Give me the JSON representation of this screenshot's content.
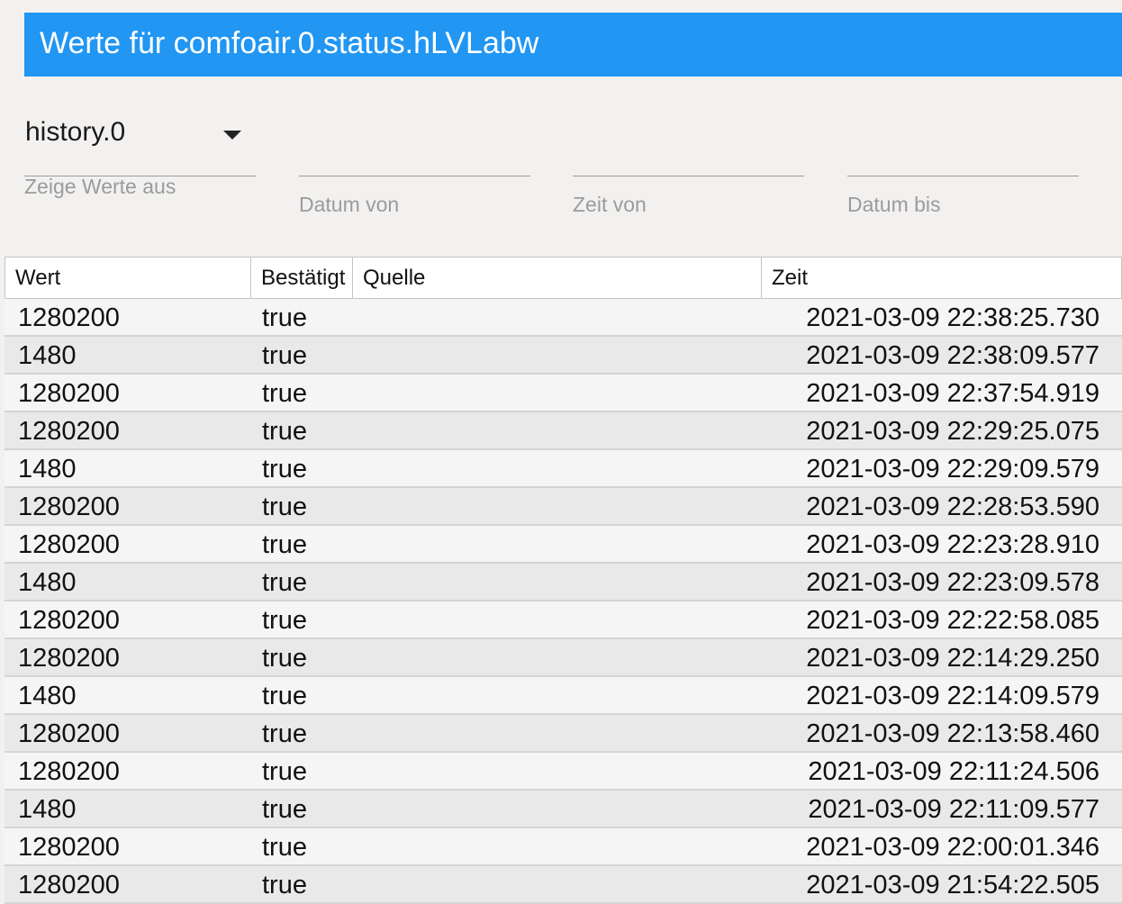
{
  "window": {
    "title": "Werte für comfoair.0.status.hLVLabw"
  },
  "filters": {
    "instance": {
      "value": "history.0",
      "label": "Zeige Werte aus"
    },
    "date_from": {
      "label": "Datum von",
      "value": ""
    },
    "time_from": {
      "label": "Zeit von",
      "value": ""
    },
    "date_to": {
      "label": "Datum bis",
      "value": ""
    }
  },
  "table": {
    "headers": {
      "value": "Wert",
      "ack": "Bestätigt",
      "from": "Quelle",
      "ts": "Zeit"
    },
    "rows": [
      {
        "value": "1280200",
        "ack": "true",
        "from": "",
        "ts": "2021-03-09 22:38:25.730"
      },
      {
        "value": "1480",
        "ack": "true",
        "from": "",
        "ts": "2021-03-09 22:38:09.577"
      },
      {
        "value": "1280200",
        "ack": "true",
        "from": "",
        "ts": "2021-03-09 22:37:54.919"
      },
      {
        "value": "1280200",
        "ack": "true",
        "from": "",
        "ts": "2021-03-09 22:29:25.075"
      },
      {
        "value": "1480",
        "ack": "true",
        "from": "",
        "ts": "2021-03-09 22:29:09.579"
      },
      {
        "value": "1280200",
        "ack": "true",
        "from": "",
        "ts": "2021-03-09 22:28:53.590"
      },
      {
        "value": "1280200",
        "ack": "true",
        "from": "",
        "ts": "2021-03-09 22:23:28.910"
      },
      {
        "value": "1480",
        "ack": "true",
        "from": "",
        "ts": "2021-03-09 22:23:09.578"
      },
      {
        "value": "1280200",
        "ack": "true",
        "from": "",
        "ts": "2021-03-09 22:22:58.085"
      },
      {
        "value": "1280200",
        "ack": "true",
        "from": "",
        "ts": "2021-03-09 22:14:29.250"
      },
      {
        "value": "1480",
        "ack": "true",
        "from": "",
        "ts": "2021-03-09 22:14:09.579"
      },
      {
        "value": "1280200",
        "ack": "true",
        "from": "",
        "ts": "2021-03-09 22:13:58.460"
      },
      {
        "value": "1280200",
        "ack": "true",
        "from": "",
        "ts": "2021-03-09 22:11:24.506"
      },
      {
        "value": "1480",
        "ack": "true",
        "from": "",
        "ts": "2021-03-09 22:11:09.577"
      },
      {
        "value": "1280200",
        "ack": "true",
        "from": "",
        "ts": "2021-03-09 22:00:01.346"
      },
      {
        "value": "1280200",
        "ack": "true",
        "from": "",
        "ts": "2021-03-09 21:54:22.505"
      }
    ]
  }
}
